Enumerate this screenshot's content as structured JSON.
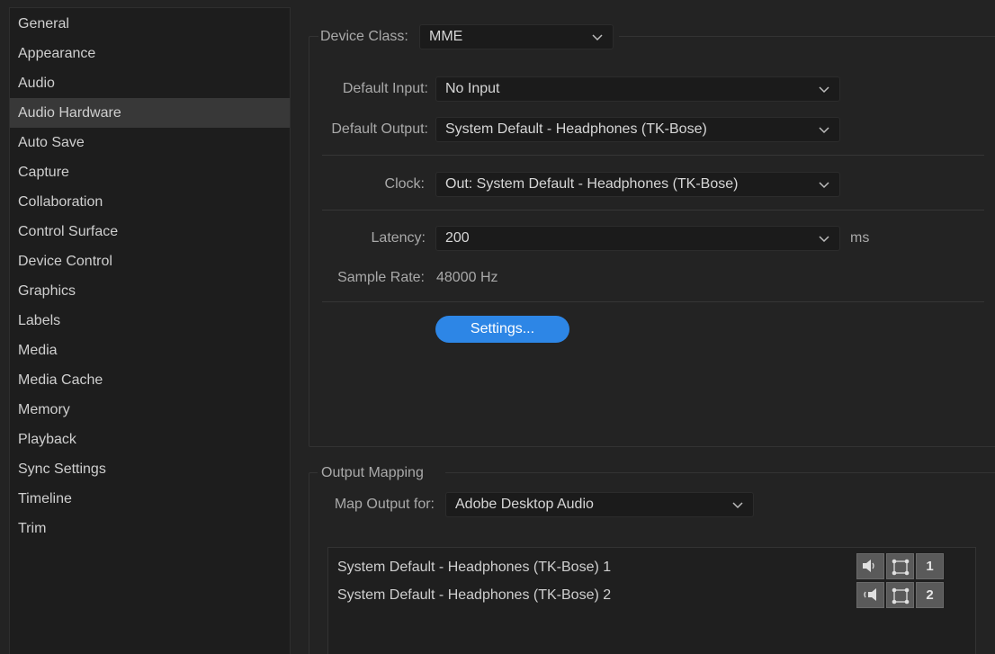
{
  "sidebar": {
    "items": [
      {
        "label": "General"
      },
      {
        "label": "Appearance"
      },
      {
        "label": "Audio"
      },
      {
        "label": "Audio Hardware",
        "selected": true
      },
      {
        "label": "Auto Save"
      },
      {
        "label": "Capture"
      },
      {
        "label": "Collaboration"
      },
      {
        "label": "Control Surface"
      },
      {
        "label": "Device Control"
      },
      {
        "label": "Graphics"
      },
      {
        "label": "Labels"
      },
      {
        "label": "Media"
      },
      {
        "label": "Media Cache"
      },
      {
        "label": "Memory"
      },
      {
        "label": "Playback"
      },
      {
        "label": "Sync Settings"
      },
      {
        "label": "Timeline"
      },
      {
        "label": "Trim"
      }
    ]
  },
  "device": {
    "class_label": "Device Class:",
    "class_value": "MME",
    "default_input_label": "Default Input:",
    "default_input_value": "No Input",
    "default_output_label": "Default Output:",
    "default_output_value": "System Default - Headphones (TK-Bose)",
    "clock_label": "Clock:",
    "clock_value": "Out: System Default - Headphones (TK-Bose)",
    "latency_label": "Latency:",
    "latency_value": "200",
    "latency_unit": "ms",
    "sample_rate_label": "Sample Rate:",
    "sample_rate_value": "48000 Hz",
    "settings_button": "Settings..."
  },
  "output_mapping": {
    "legend": "Output Mapping",
    "map_for_label": "Map Output for:",
    "map_for_value": "Adobe Desktop Audio",
    "rows": [
      {
        "name": "System Default - Headphones (TK-Bose) 1",
        "channel": "1",
        "speaker_icon": "left-speaker-icon"
      },
      {
        "name": "System Default - Headphones (TK-Bose) 2",
        "channel": "2",
        "speaker_icon": "right-speaker-icon"
      }
    ]
  },
  "colors": {
    "accent": "#2d86e6",
    "background": "#232323",
    "sidebar_selected": "#383838"
  }
}
